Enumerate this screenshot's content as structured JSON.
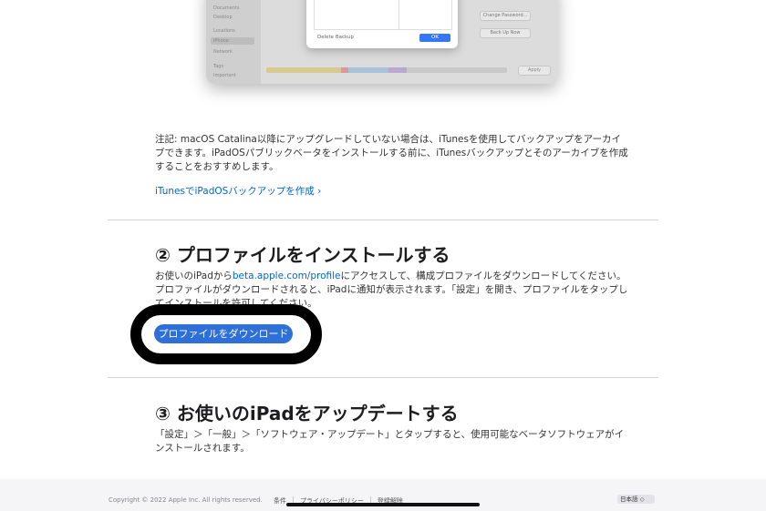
{
  "screenshot_dialog": {
    "sidebar_items": [
      "Documents",
      "Desktop",
      "Locations",
      "iPhone",
      "Network",
      "Tags",
      "Important"
    ],
    "delete_label": "Delete Backup",
    "ok_label": "OK",
    "change_password_label": "Change Password...",
    "back_up_now_label": "Back Up Now",
    "apply_label": "Apply"
  },
  "note_text": "注記: macOS Catalina以降にアップグレードしていない場合は、iTunesを使用してバックアップをアーカイブできます。iPadOSパブリックベータをインストールする前に、iTunesバックアップとそのアーカイブを作成することをおすすめします。",
  "itunes_link": "iTunesでiPadOSバックアップを作成 ›",
  "section2": {
    "title": "② プロファイルをインストールする",
    "body_before": "お使いのiPadから",
    "body_link": "beta.apple.com/profile",
    "body_after": "にアクセスして、構成プロファイルをダウンロードしてください。プロファイルがダウンロードされると、iPadに通知が表示されます。「設定」を開き、プロファイルをタップしてインストールを許可してください。",
    "button_label": "プロファイルをダウンロード"
  },
  "section3": {
    "title": "③ お使いのiPadをアップデートする",
    "body": "「設定」＞「一般」＞「ソフトウェア・アップデート」とタップすると、使用可能なベータソフトウェアがインストールされます。"
  },
  "footer": {
    "copyright": "Copyright © 2022 Apple Inc. All rights reserved.",
    "links": [
      "条件",
      "プライバシーポリシー",
      "登録解除"
    ],
    "language": "日本語 ◇"
  },
  "colors": {
    "accent": "#0066cc",
    "button": "#2f6fd8"
  }
}
